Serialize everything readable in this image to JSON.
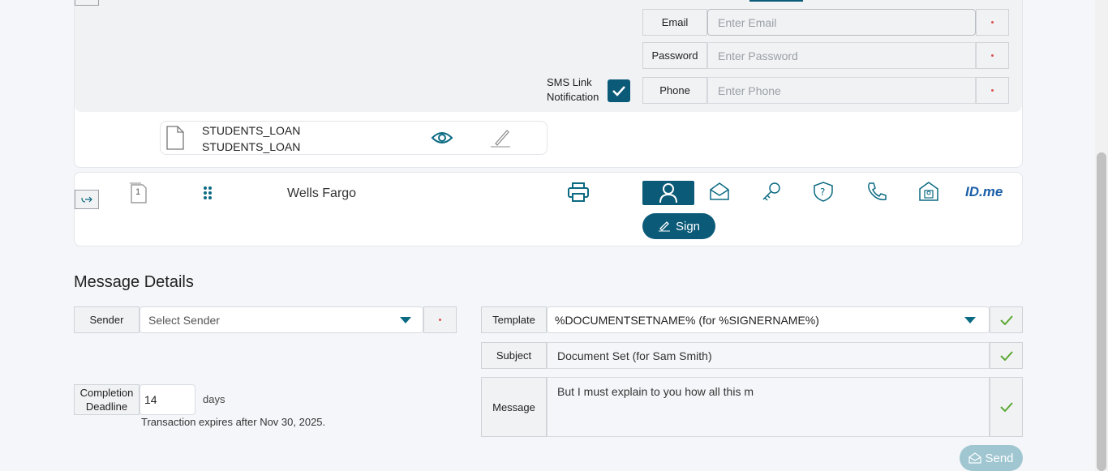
{
  "auth": {
    "email_label": "Email",
    "email_placeholder": "Enter Email",
    "password_label": "Password",
    "password_placeholder": "Enter Password",
    "phone_label": "Phone",
    "phone_placeholder": "Enter Phone",
    "sms_label_line1": "SMS Link",
    "sms_label_line2": "Notification",
    "sms_checked": true
  },
  "document": {
    "name_line1": "STUDENTS_LOAN",
    "name_line2": "STUDENTS_LOAN"
  },
  "signer": {
    "order_number": "1",
    "name": "Wells Fargo",
    "sign_label": "Sign",
    "idme_label": "ID.me"
  },
  "message_details": {
    "title": "Message Details",
    "sender_label": "Sender",
    "sender_placeholder": "Select Sender",
    "completion_label_line1": "Completion",
    "completion_label_line2": "Deadline",
    "deadline_value": "14",
    "deadline_unit": "days",
    "expiry_note": "Transaction expires after Nov 30, 2025.",
    "template_label": "Template",
    "template_value": "%DOCUMENTSETNAME% (for %SIGNERNAME%)",
    "subject_label": "Subject",
    "subject_value": "Document Set (for Sam Smith)",
    "message_label": "Message",
    "message_value": "But I must explain to you how all this m",
    "send_label": "Send"
  },
  "colors": {
    "primary": "#0a5a78",
    "accent_check": "#5aa832",
    "required_dot": "#d9534f",
    "send_disabled": "#9fc6d1"
  }
}
